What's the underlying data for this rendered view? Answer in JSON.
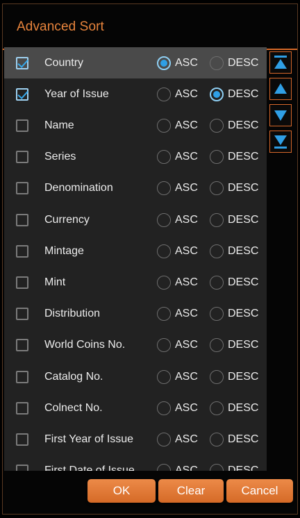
{
  "dialog": {
    "title": "Advanced Sort"
  },
  "sort_options": {
    "asc_label": "ASC",
    "desc_label": "DESC"
  },
  "fields": [
    {
      "label": "Country",
      "checked": true,
      "direction": "ASC",
      "selected": true
    },
    {
      "label": "Year of Issue",
      "checked": true,
      "direction": "DESC",
      "selected": false
    },
    {
      "label": "Name",
      "checked": false,
      "direction": null,
      "selected": false
    },
    {
      "label": "Series",
      "checked": false,
      "direction": null,
      "selected": false
    },
    {
      "label": "Denomination",
      "checked": false,
      "direction": null,
      "selected": false
    },
    {
      "label": "Currency",
      "checked": false,
      "direction": null,
      "selected": false
    },
    {
      "label": "Mintage",
      "checked": false,
      "direction": null,
      "selected": false
    },
    {
      "label": "Mint",
      "checked": false,
      "direction": null,
      "selected": false
    },
    {
      "label": "Distribution",
      "checked": false,
      "direction": null,
      "selected": false
    },
    {
      "label": "World Coins No.",
      "checked": false,
      "direction": null,
      "selected": false
    },
    {
      "label": "Catalog No.",
      "checked": false,
      "direction": null,
      "selected": false
    },
    {
      "label": "Colnect No.",
      "checked": false,
      "direction": null,
      "selected": false
    },
    {
      "label": "First Year of Issue",
      "checked": false,
      "direction": null,
      "selected": false
    },
    {
      "label": "First Date of Issue",
      "checked": false,
      "direction": null,
      "selected": false
    }
  ],
  "move_controls": [
    {
      "icon": "move-to-top-icon"
    },
    {
      "icon": "move-up-icon"
    },
    {
      "icon": "move-down-icon"
    },
    {
      "icon": "move-to-bottom-icon"
    }
  ],
  "buttons": {
    "ok": "OK",
    "clear": "Clear",
    "cancel": "Cancel"
  },
  "colors": {
    "accent": "#d86a28",
    "title": "#e8843c",
    "check_blue": "#2f9fe6",
    "list_bg": "#222222",
    "selected_row_bg": "#4a4a4a"
  }
}
